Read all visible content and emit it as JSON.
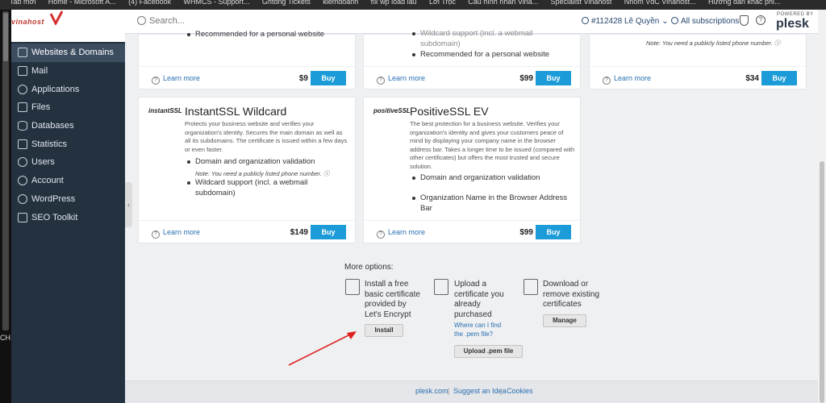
{
  "bookmarks": [
    "Tab mới",
    "Home - Microsoft A...",
    "(4) Facebook",
    "WHMCS - Support...",
    "Ghtdng Tickets",
    "kiemdoanh",
    "fix wp load lâu",
    "Lời Trọc",
    "Cấu hình nhân Vina...",
    "Specialist Vinahost",
    "Nhóm VdC Vinahost...",
    "Hướng dẫn khắc phi..."
  ],
  "left_edge_label": "CH",
  "logo": {
    "text": "vinahost"
  },
  "sidebar": {
    "items": [
      {
        "label": "Websites & Domains",
        "icon": "globe-icon",
        "active": true
      },
      {
        "label": "Mail",
        "icon": "mail-icon"
      },
      {
        "label": "Applications",
        "icon": "gear-icon"
      },
      {
        "label": "Files",
        "icon": "folder-icon"
      },
      {
        "label": "Databases",
        "icon": "database-icon"
      },
      {
        "label": "Statistics",
        "icon": "chart-icon"
      },
      {
        "label": "Users",
        "icon": "user-icon"
      },
      {
        "label": "Account",
        "icon": "account-icon"
      },
      {
        "label": "WordPress",
        "icon": "wordpress-icon"
      },
      {
        "label": "SEO Toolkit",
        "icon": "seo-icon"
      }
    ]
  },
  "header": {
    "search_placeholder": "Search...",
    "account": "#112428 Lê Quyền ⌄",
    "subscriptions": "All subscriptions",
    "powered_by": "POWERED BY",
    "brand": "plesk"
  },
  "top_cards": [
    {
      "bullets": [
        "Recommended for a personal website"
      ],
      "learn_more": "Learn more",
      "price": "$9",
      "buy": "Buy"
    },
    {
      "bullets": [
        "Wildcard support (incl. a webmail subdomain)",
        "Recommended for a personal website"
      ],
      "learn_more": "Learn more",
      "price": "$99",
      "buy": "Buy"
    },
    {
      "note": "Note: You need a publicly listed phone number.",
      "learn_more": "Learn more",
      "price": "$34",
      "buy": "Buy"
    }
  ],
  "cards": [
    {
      "brand": "instantSSL",
      "title": "InstantSSL Wildcard",
      "description": "Protects your business website and verifies your organization's identity. Secures the main domain as well as all its subdomains. The certificate is issued within a few days or even faster.",
      "bullets": [
        "Domain and organization validation",
        "Wildcard support (incl. a webmail subdomain)"
      ],
      "note": "Note: You need a publicly listed phone number.",
      "learn_more": "Learn more",
      "price": "$149",
      "buy": "Buy"
    },
    {
      "brand": "positiveSSL",
      "title": "PositiveSSL EV",
      "description": "The best protection for a business website. Verifies your organization's identity and gives your customers peace of mind by displaying your company name in the browser address bar. Takes a longer time to be issued (compared with other certificates) but offers the most trusted and secure solution.",
      "bullets": [
        "Domain and organization validation",
        "Organization Name in the Browser Address Bar"
      ],
      "learn_more": "Learn more",
      "price": "$99",
      "buy": "Buy"
    }
  ],
  "more_options": {
    "title": "More options:",
    "options": [
      {
        "text": "Install a free basic certificate provided by Let's Encrypt",
        "button": "Install",
        "icon": "certificate-icon"
      },
      {
        "text": "Upload a certificate you already purchased",
        "link": "Where can I find the .pem file?",
        "button": "Upload .pem file",
        "icon": "upload-icon"
      },
      {
        "text": "Download or remove existing certificates",
        "button": "Manage",
        "icon": "download-icon"
      }
    ]
  },
  "footer": {
    "links": [
      "plesk.com",
      "Suggest an Idea",
      "Cookies"
    ]
  },
  "colors": {
    "accent": "#1b9bd7",
    "sidebar": "#243240",
    "annotation_arrow": "#e02020"
  }
}
